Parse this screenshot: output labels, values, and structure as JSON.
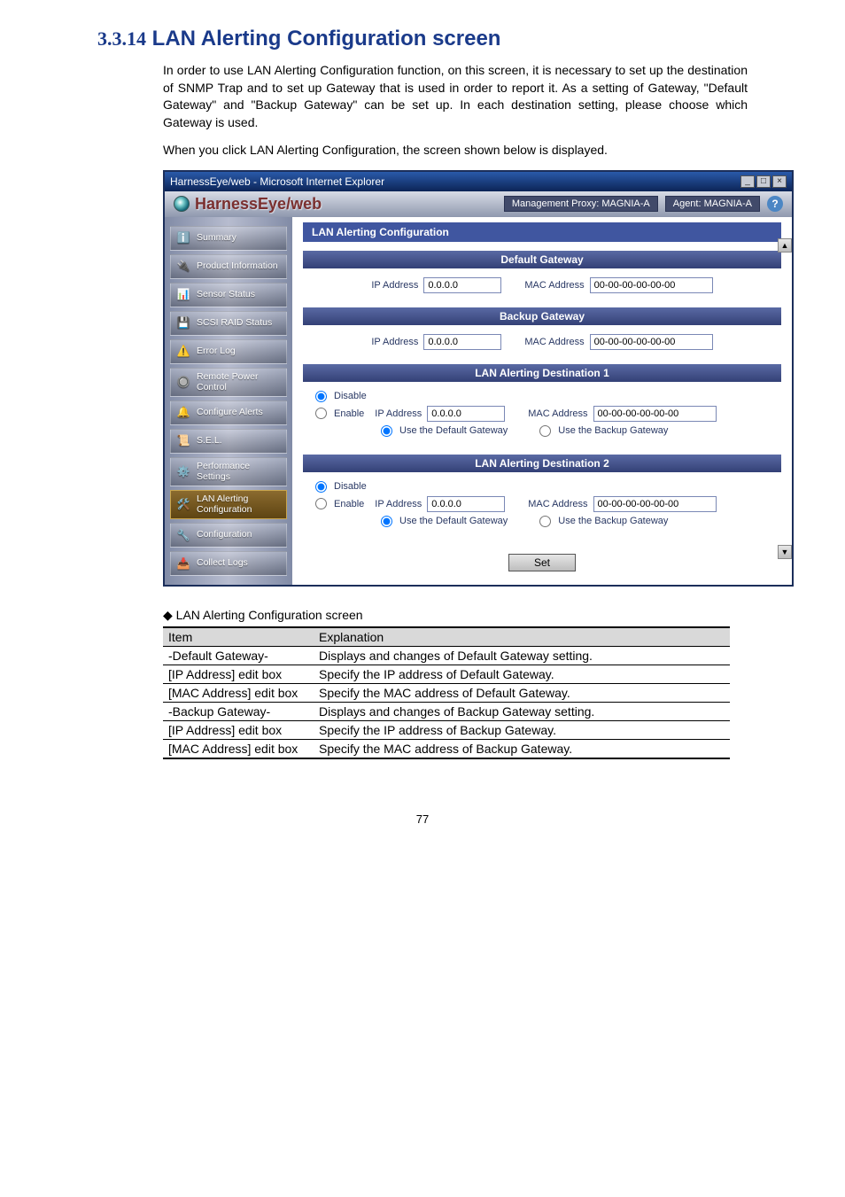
{
  "heading": {
    "num": "3.3.14",
    "title": "LAN Alerting Configuration screen"
  },
  "intro": {
    "p1": "In order to use LAN Alerting Configuration function, on this screen, it is necessary to set up the destination of SNMP Trap and to set up Gateway that is used in order to report it. As a setting of Gateway, \"Default Gateway\" and \"Backup Gateway\" can be set up. In each destination setting, please choose which Gateway is used.",
    "p2": "When you click LAN Alerting Configuration, the screen shown below is displayed."
  },
  "window_title": "HarnessEye/web - Microsoft Internet Explorer",
  "brand": "HarnessEye/web",
  "agent": {
    "proxy": "Management Proxy: MAGNIA-A",
    "agent": "Agent: MAGNIA-A",
    "help": "?"
  },
  "nav": [
    {
      "icon": "ℹ️",
      "label": "Summary",
      "name": "nav-summary"
    },
    {
      "icon": "🔌",
      "label": "Product Information",
      "name": "nav-product-information"
    },
    {
      "icon": "📊",
      "label": "Sensor Status",
      "name": "nav-sensor-status"
    },
    {
      "icon": "💾",
      "label": "SCSI RAID Status",
      "name": "nav-scsi-raid-status"
    },
    {
      "icon": "⚠️",
      "label": "Error Log",
      "name": "nav-error-log"
    },
    {
      "icon": "🔘",
      "label": "Remote Power Control",
      "name": "nav-remote-power-control"
    },
    {
      "icon": "🔔",
      "label": "Configure Alerts",
      "name": "nav-configure-alerts"
    },
    {
      "icon": "📜",
      "label": "S.E.L.",
      "name": "nav-sel"
    },
    {
      "icon": "⚙️",
      "label": "Performance Settings",
      "name": "nav-performance-settings"
    },
    {
      "icon": "🛠️",
      "label": "LAN Alerting Configuration",
      "name": "nav-lan-alerting-configuration",
      "active": true
    },
    {
      "icon": "🔧",
      "label": "Configuration",
      "name": "nav-configuration"
    },
    {
      "icon": "📥",
      "label": "Collect Logs",
      "name": "nav-collect-logs"
    }
  ],
  "pane_title": "LAN Alerting Configuration",
  "labels": {
    "ip": "IP Address",
    "mac": "MAC Address",
    "disable": "Disable",
    "enable": "Enable",
    "use_default": "Use the Default Gateway",
    "use_backup": "Use the Backup Gateway",
    "set": "Set"
  },
  "sections": {
    "default_gw": {
      "title": "Default Gateway",
      "ip": "0.0.0.0",
      "mac": "00-00-00-00-00-00"
    },
    "backup_gw": {
      "title": "Backup Gateway",
      "ip": "0.0.0.0",
      "mac": "00-00-00-00-00-00"
    },
    "dest1": {
      "title": "LAN Alerting Destination 1",
      "ip": "0.0.0.0",
      "mac": "00-00-00-00-00-00"
    },
    "dest2": {
      "title": "LAN Alerting Destination 2",
      "ip": "0.0.0.0",
      "mac": "00-00-00-00-00-00"
    }
  },
  "table": {
    "caption": "LAN Alerting Configuration screen",
    "headers": {
      "item": "Item",
      "expl": "Explanation"
    },
    "rows": [
      {
        "item": "-Default Gateway-",
        "expl": "Displays and changes of Default Gateway setting."
      },
      {
        "item": "[IP Address] edit box",
        "expl": "Specify the IP address of Default Gateway."
      },
      {
        "item": "[MAC Address] edit box",
        "expl": "Specify the MAC address of Default Gateway."
      },
      {
        "item": "-Backup Gateway-",
        "expl": "Displays and changes of Backup Gateway setting."
      },
      {
        "item": "[IP Address] edit box",
        "expl": "Specify the IP address of Backup Gateway."
      },
      {
        "item": "[MAC Address] edit box",
        "expl": "Specify the MAC address of Backup Gateway."
      }
    ]
  },
  "page": "77"
}
